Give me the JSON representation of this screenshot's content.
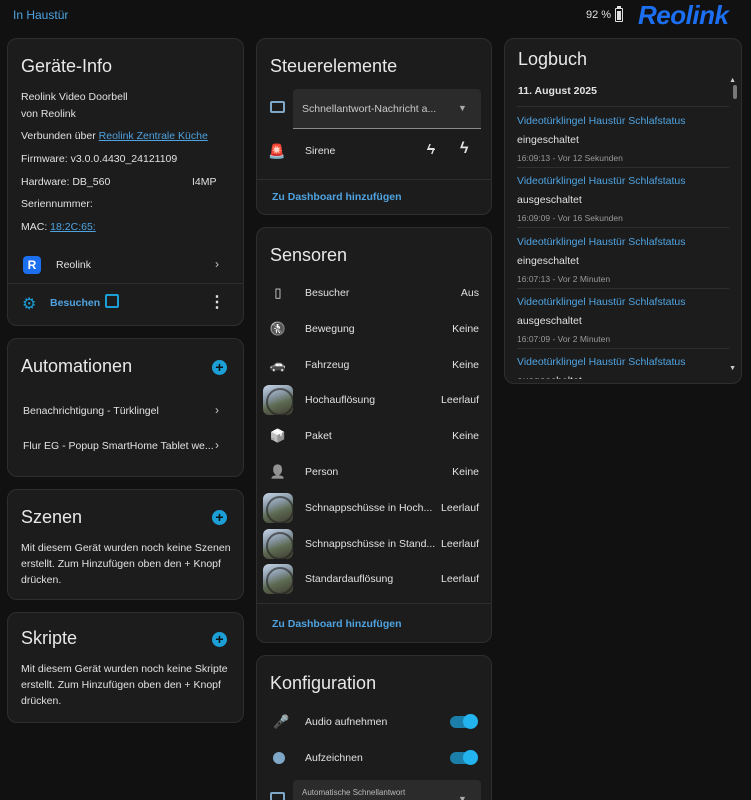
{
  "header": {
    "area": "In Haustür",
    "battery": "92 %",
    "brand": "Reolink"
  },
  "device_info": {
    "title": "Geräte-Info",
    "model": "Reolink Video Doorbell",
    "vendor": "von Reolink",
    "connected_prefix": "Verbunden über",
    "connected_link": "Reolink Zentrale Küche",
    "firmware": "Firmware: v3.0.0.4430_24121109",
    "hardware_label": "Hardware: DB_560",
    "hardware_tail": "I4MP",
    "serial": "Seriennummer:",
    "mac_label": "MAC:",
    "mac_value": "18:2C:65:",
    "integration": "Reolink",
    "visit": "Besuchen"
  },
  "automations": {
    "title": "Automationen",
    "items": [
      "Benachrichtigung - Türklingel",
      "Flur EG - Popup SmartHome Tablet we..."
    ]
  },
  "scenes": {
    "title": "Szenen",
    "text": "Mit diesem Gerät wurden noch keine Szenen erstellt. Zum Hinzufügen oben den + Knopf drücken."
  },
  "scripts": {
    "title": "Skripte",
    "text": "Mit diesem Gerät wurden noch keine Skripte erstellt. Zum Hinzufügen oben den + Knopf drücken."
  },
  "controls": {
    "title": "Steuerelemente",
    "select_value": "Schnellantwort-Nachricht a...",
    "siren": "Sirene",
    "add_dashboard": "Zu Dashboard hinzufügen"
  },
  "sensors": {
    "title": "Sensoren",
    "items": [
      {
        "name": "Besucher",
        "state": "Aus",
        "icon": "doorbell-icon",
        "glyph": "▯",
        "thumb": false
      },
      {
        "name": "Bewegung",
        "state": "Keine",
        "icon": "motion-off-icon",
        "glyph": "🚷",
        "thumb": false
      },
      {
        "name": "Fahrzeug",
        "state": "Keine",
        "icon": "car-off-icon",
        "glyph": "🚗",
        "thumb": false
      },
      {
        "name": "Hochauflösung",
        "state": "Leerlauf",
        "icon": "camera-thumbnail",
        "glyph": "",
        "thumb": true
      },
      {
        "name": "Paket",
        "state": "Keine",
        "icon": "package-off-icon",
        "glyph": "📦",
        "thumb": false
      },
      {
        "name": "Person",
        "state": "Keine",
        "icon": "person-off-icon",
        "glyph": "👤",
        "thumb": false
      },
      {
        "name": "Schnappschüsse in Hoch...",
        "state": "Leerlauf",
        "icon": "camera-thumbnail",
        "glyph": "",
        "thumb": true
      },
      {
        "name": "Schnappschüsse in Stand...",
        "state": "Leerlauf",
        "icon": "camera-thumbnail",
        "glyph": "",
        "thumb": true
      },
      {
        "name": "Standardauflösung",
        "state": "Leerlauf",
        "icon": "camera-thumbnail",
        "glyph": "",
        "thumb": true
      }
    ],
    "add_dashboard": "Zu Dashboard hinzufügen"
  },
  "config": {
    "title": "Konfiguration",
    "audio": "Audio aufnehmen",
    "record": "Aufzeichnen",
    "select_label": "Automatische Schnellantwort"
  },
  "logbook": {
    "title": "Logbuch",
    "date": "11. August 2025",
    "entries": [
      {
        "entity": "Videotürklingel Haustür Schlafstatus",
        "state": "eingeschaltet",
        "time": "16:09:13 - Vor 12 Sekunden"
      },
      {
        "entity": "Videotürklingel Haustür Schlafstatus",
        "state": "ausgeschaltet",
        "time": "16:09:09 - Vor 16 Sekunden"
      },
      {
        "entity": "Videotürklingel Haustür Schlafstatus",
        "state": "eingeschaltet",
        "time": "16:07:13 - Vor 2 Minuten"
      },
      {
        "entity": "Videotürklingel Haustür Schlafstatus",
        "state": "ausgeschaltet",
        "time": "16:07:09 - Vor 2 Minuten"
      },
      {
        "entity": "Videotürklingel Haustür Schlafstatus",
        "state": "ausgeschaltet",
        "time": ""
      }
    ]
  },
  "colors": {
    "accent": "#1b9fd6",
    "link": "#4fa3e0",
    "brand": "#1d6ff2",
    "background": "#111111",
    "card": "#1c1c1c"
  }
}
